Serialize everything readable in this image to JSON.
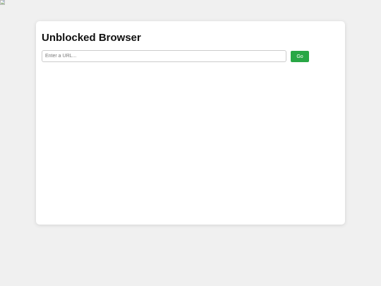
{
  "page": {
    "title": "Unblocked Browser"
  },
  "url_bar": {
    "placeholder": "Enter a URL...",
    "value": ""
  },
  "go_button": {
    "label": "Go"
  },
  "colors": {
    "page_background": "#f0f0f0",
    "card_background": "#ffffff",
    "go_button": "#28a745"
  },
  "icons": {
    "broken_image": "broken-image-icon"
  }
}
